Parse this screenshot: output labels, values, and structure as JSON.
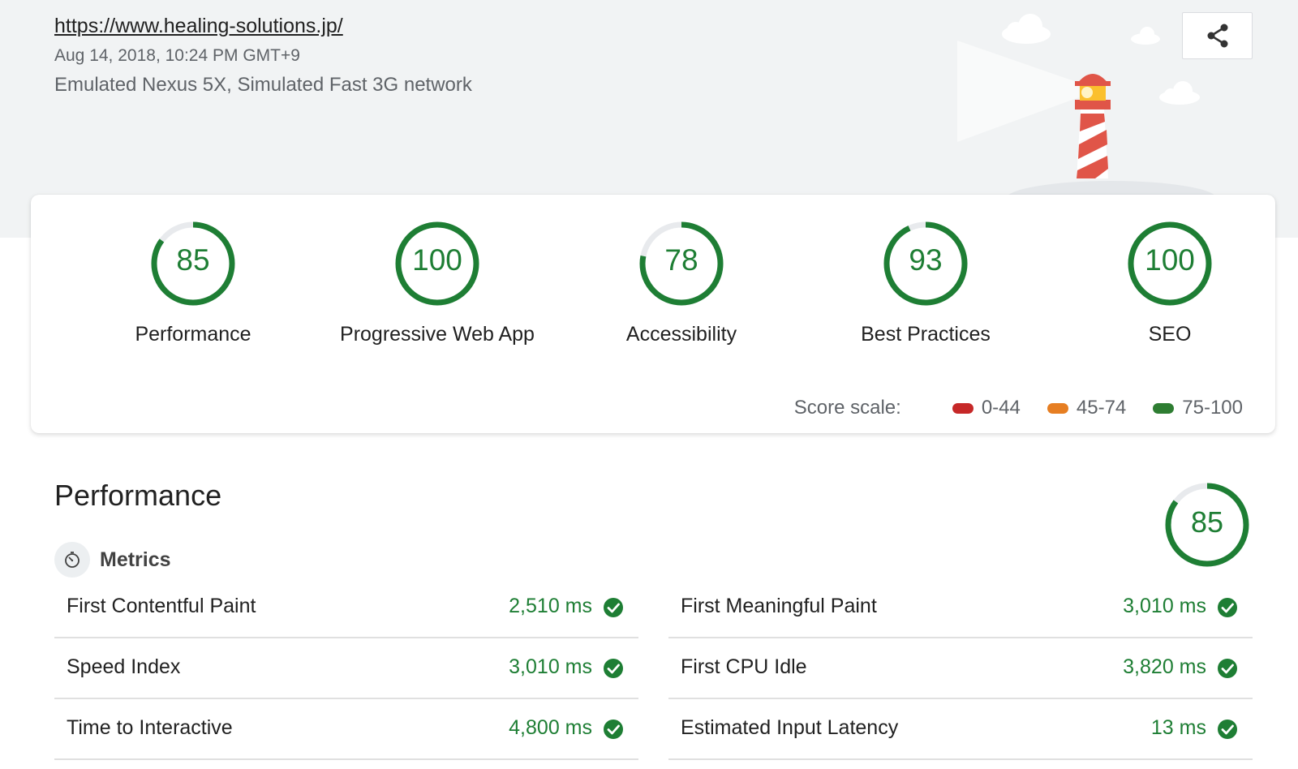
{
  "header": {
    "url": "https://www.healing-solutions.jp/",
    "date": "Aug 14, 2018, 10:24 PM GMT+9",
    "environment": "Emulated Nexus 5X, Simulated Fast 3G network",
    "share_icon": "share-icon"
  },
  "categories": [
    {
      "score": "85",
      "label": "Performance",
      "fraction": 0.85
    },
    {
      "score": "100",
      "label": "Progressive Web App",
      "fraction": 1.0
    },
    {
      "score": "78",
      "label": "Accessibility",
      "fraction": 0.78
    },
    {
      "score": "93",
      "label": "Best Practices",
      "fraction": 0.93
    },
    {
      "score": "100",
      "label": "SEO",
      "fraction": 1.0
    }
  ],
  "score_scale": {
    "title": "Score scale:",
    "ranges": [
      {
        "label": "0-44",
        "color": "#c62828"
      },
      {
        "label": "45-74",
        "color": "#e67e22"
      },
      {
        "label": "75-100",
        "color": "#2e7d32"
      }
    ]
  },
  "performance": {
    "title": "Performance",
    "score": "85",
    "fraction": 0.85,
    "metrics_title": "Metrics",
    "metrics_icon": "stopwatch-icon",
    "metrics": [
      {
        "label": "First Contentful Paint",
        "value": "2,510 ms"
      },
      {
        "label": "First Meaningful Paint",
        "value": "3,010 ms"
      },
      {
        "label": "Speed Index",
        "value": "3,010 ms"
      },
      {
        "label": "First CPU Idle",
        "value": "3,820 ms"
      },
      {
        "label": "Time to Interactive",
        "value": "4,800 ms"
      },
      {
        "label": "Estimated Input Latency",
        "value": "13 ms"
      }
    ],
    "pass_icon": "check-circle-icon"
  },
  "colors": {
    "pass": "#1e7e34",
    "gauge_track": "#e8eaed",
    "background_band": "#f1f3f4"
  }
}
